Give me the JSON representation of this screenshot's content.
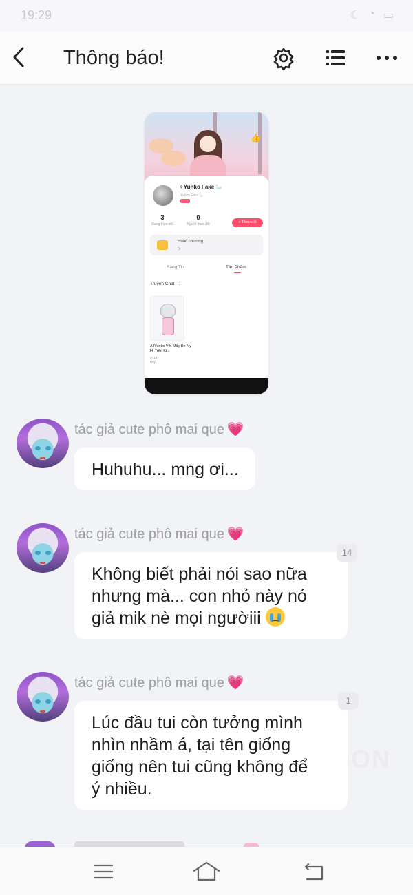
{
  "status_bar": {
    "time": "19:29"
  },
  "header": {
    "title": "Thông báo!"
  },
  "shared_screenshot": {
    "username": "✧Yunko Fake 🦢",
    "username_sub": "Yunko Fake 🦢",
    "following_count": "3",
    "following_label": "Đang theo dõi",
    "followers_count": "0",
    "followers_label": "Người theo dõi",
    "follow_button": "+ Theo dõi",
    "medal_label": "Huân chương",
    "medal_count": "0",
    "tab_news": "Bảng Tin",
    "tab_works": "Tác Phẩm",
    "section_title": "Truyện Chat",
    "section_count": "1",
    "story_title": "AllYunko Với Mấy Bn Ny Hi Trên Ki...",
    "story_views": "18",
    "story_status": "Hủy"
  },
  "messages": [
    {
      "sender": "tác giả cute phô mai que",
      "text": "Huhuhu... mng ơi...",
      "reads": ""
    },
    {
      "sender": "tác giả cute phô mai que",
      "lines": [
        "Không biết phải nói sao nữa",
        "nhưng mà... con nhỏ này nó",
        "giả mik nè mọi ngườiii"
      ],
      "reads": "14",
      "emoji": "loudly-crying-face"
    },
    {
      "sender": "tác giả cute phô mai que",
      "lines": [
        "Lúc đầu tui còn tưởng mình",
        "nhìn nhầm á, tại tên giống",
        "giống nên tui cũng không để",
        "ý nhiều."
      ],
      "reads": "1"
    }
  ],
  "watermark": "OON",
  "colors": {
    "accent": "#ff4d6e",
    "heart": "#f08fb3",
    "background": "#f2f3f7"
  }
}
